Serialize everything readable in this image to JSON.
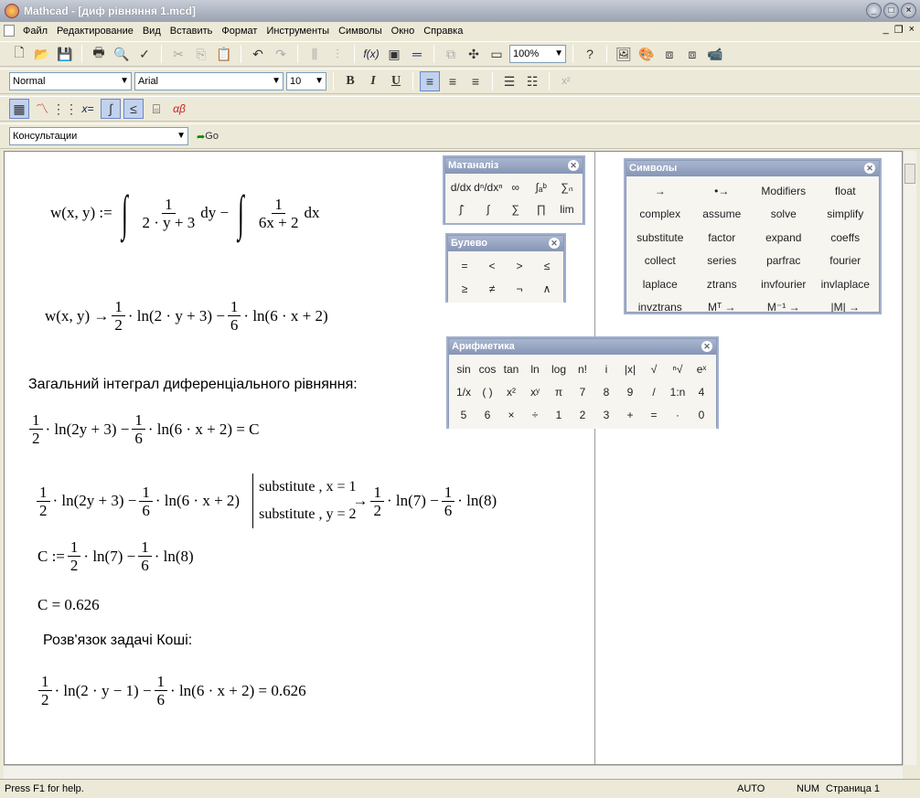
{
  "window": {
    "title": "Mathcad - [диф рівняння 1.mcd]"
  },
  "menu": [
    "Файл",
    "Редактирование",
    "Вид",
    "Вставить",
    "Формат",
    "Инструменты",
    "Символы",
    "Окно",
    "Справка"
  ],
  "toolbar_std": {
    "zoom": "100%"
  },
  "toolbar_fmt": {
    "style": "Normal",
    "font": "Arial",
    "size": "10"
  },
  "toolbar_res": {
    "resources": "Консультации",
    "go": "Go"
  },
  "doc": {
    "def_w": "w(x, y) :=",
    "def_f1_num": "1",
    "def_f1_den": "2 · y + 3",
    "def_dy": "dy −",
    "def_f2_num": "1",
    "def_f2_den": "6x + 2",
    "def_dx": "dx",
    "res_lhs": "w(x, y) →",
    "res_h_num": "1",
    "res_h_den": "2",
    "res_mid": "· ln(2 · y + 3) −",
    "res_s_num": "1",
    "res_s_den": "6",
    "res_end": "· ln(6 · x + 2)",
    "heading1": "Загальний інтеграл диференціального рівняння:",
    "g_mid": "· ln(2y + 3) −",
    "g_end": "· ln(6 · x + 2) = C",
    "s_mid": "· ln(2y + 3) −",
    "s_end": "· ln(6 · x + 2)",
    "s_sub1": "substitute , x = 1",
    "s_sub2": "substitute , y = 2",
    "s_arrow": "→",
    "s_r1": "· ln(7) −",
    "s_r2": "· ln(8)",
    "c_def": "C :=",
    "c_r1": "· ln(7) −",
    "c_r2": "· ln(8)",
    "c_val": "C = 0.626",
    "heading2": "Розв'язок задачі Коші:",
    "k_mid": "· ln(2 · y − 1) −",
    "k_end": "· ln(6 · x + 2) = 0.626",
    "one": "1",
    "two": "2",
    "six": "6"
  },
  "palettes": {
    "matanaliz": {
      "title": "Матаналіз",
      "cells": [
        "d/dx",
        "dⁿ/dxⁿ",
        "∞",
        "∫ₐᵇ",
        "∑ₙ",
        "∫̄",
        "∫",
        "∑",
        "∏",
        "lim"
      ]
    },
    "bool": {
      "title": "Булево",
      "cells": [
        "=",
        "<",
        ">",
        "≤",
        "≥",
        "≠",
        "¬",
        "∧"
      ]
    },
    "symbols": {
      "title": "Символы",
      "cells": [
        "→",
        "•→",
        "Modifiers",
        "float",
        "complex",
        "assume",
        "solve",
        "simplify",
        "substitute",
        "factor",
        "expand",
        "coeffs",
        "collect",
        "series",
        "parfrac",
        "fourier",
        "laplace",
        "ztrans",
        "invfourier",
        "invlaplace",
        "invztrans",
        "Mᵀ →",
        "M⁻¹ →",
        "|M| →"
      ]
    },
    "arith": {
      "title": "Арифметика",
      "cells": [
        "sin",
        "cos",
        "tan",
        "ln",
        "log",
        "n!",
        "i",
        "|x|",
        "√",
        "ⁿ√",
        "eˣ",
        "1/x",
        "( )",
        "x²",
        "xʸ",
        "π",
        "7",
        "8",
        "9",
        "/",
        "1:n",
        "4",
        "5",
        "6",
        "×",
        "÷",
        "1",
        "2",
        "3",
        "+",
        "=",
        "·",
        "0"
      ]
    }
  },
  "status": {
    "help": "Press F1 for help.",
    "auto": "AUTO",
    "num": "NUM",
    "page": "Страница 1"
  }
}
